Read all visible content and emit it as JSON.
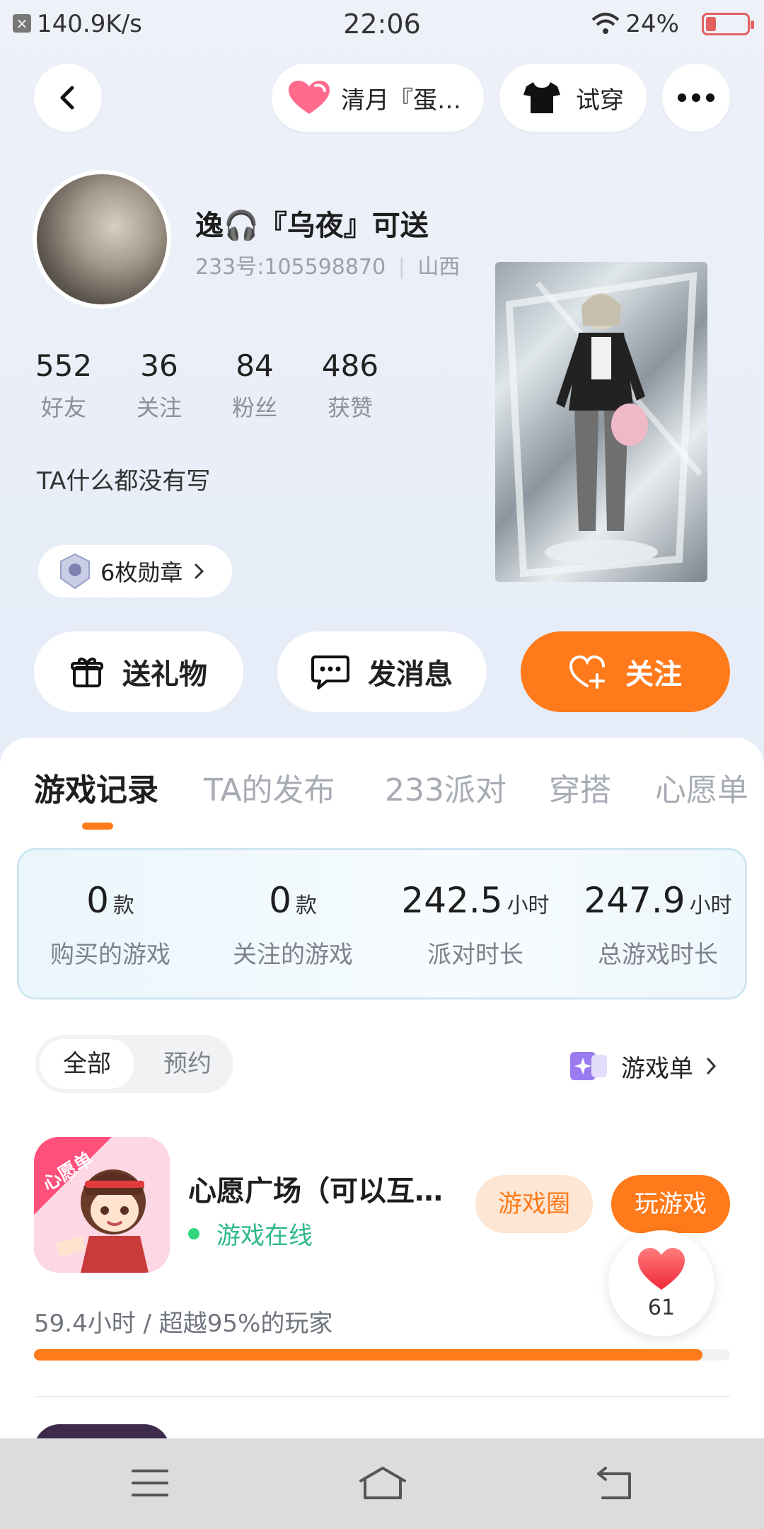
{
  "status": {
    "speed": "140.9K/s",
    "time": "22:06",
    "battery": "24%"
  },
  "topnav": {
    "heart_label": "清月『蛋…",
    "tryon_label": "试穿"
  },
  "profile": {
    "username": "逸🎧『乌夜』可送",
    "uid_text": "233号:105598870",
    "region": "山西",
    "stats": [
      {
        "num": "552",
        "label": "好友"
      },
      {
        "num": "36",
        "label": "关注"
      },
      {
        "num": "84",
        "label": "粉丝"
      },
      {
        "num": "486",
        "label": "获赞"
      }
    ],
    "bio": "TA什么都没有写",
    "badge_label": "6枚勋章"
  },
  "actions": {
    "gift": "送礼物",
    "message": "发消息",
    "follow": "关注"
  },
  "tabs": [
    "游戏记录",
    "TA的发布",
    "233派对",
    "穿搭",
    "心愿单"
  ],
  "game_stats": [
    {
      "value": "0",
      "unit": "款",
      "label": "购买的游戏"
    },
    {
      "value": "0",
      "unit": "款",
      "label": "关注的游戏"
    },
    {
      "value": "242.5",
      "unit": "小时",
      "label": "派对时长"
    },
    {
      "value": "247.9",
      "unit": "小时",
      "label": "总游戏时长"
    }
  ],
  "filter": {
    "all": "全部",
    "reserve": "预约",
    "game_list": "游戏单"
  },
  "game": {
    "icon_tag": "心愿单",
    "title": "心愿广场（可以互…",
    "status": "游戏在线",
    "circle_btn": "游戏圈",
    "play_btn": "玩游戏",
    "playtime": "59.4小时 / 超越95%的玩家",
    "progress": 0.96
  },
  "like_count": "61",
  "colors": {
    "accent": "#ff7a1a",
    "online": "#2fb989"
  }
}
